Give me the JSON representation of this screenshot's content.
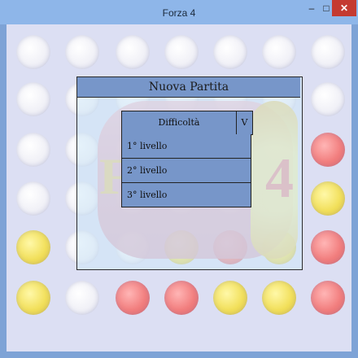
{
  "window": {
    "title": "Forza 4",
    "minimize_glyph": "–",
    "maximize_glyph": "□",
    "close_glyph": "✕"
  },
  "colors": {
    "titlebar": "#8eb6e9",
    "dialog_header": "#7796c9",
    "close_button": "#c43a31",
    "disc_yellow": "#f2e05c",
    "disc_red": "#f27f7f"
  },
  "board": {
    "rows": [
      [
        "white",
        "white",
        "white",
        "white",
        "white",
        "white",
        "white"
      ],
      [
        "white",
        "white",
        "white",
        "white",
        "white",
        "white",
        "white"
      ],
      [
        "white",
        "white",
        "white",
        "white",
        "white",
        "white",
        "red"
      ],
      [
        "white",
        "white",
        "white",
        "white",
        "white",
        "white",
        "yellow"
      ],
      [
        "yellow",
        "white",
        "white",
        "yellow",
        "red",
        "yellow",
        "red"
      ],
      [
        "yellow",
        "white",
        "red",
        "red",
        "yellow",
        "yellow",
        "red"
      ]
    ]
  },
  "dialog": {
    "title": "Nuova Partita",
    "difficulty_label": "Difficoltà",
    "dropdown_arrow": "V",
    "options": [
      "1° livello",
      "2° livello",
      "3° livello"
    ]
  }
}
